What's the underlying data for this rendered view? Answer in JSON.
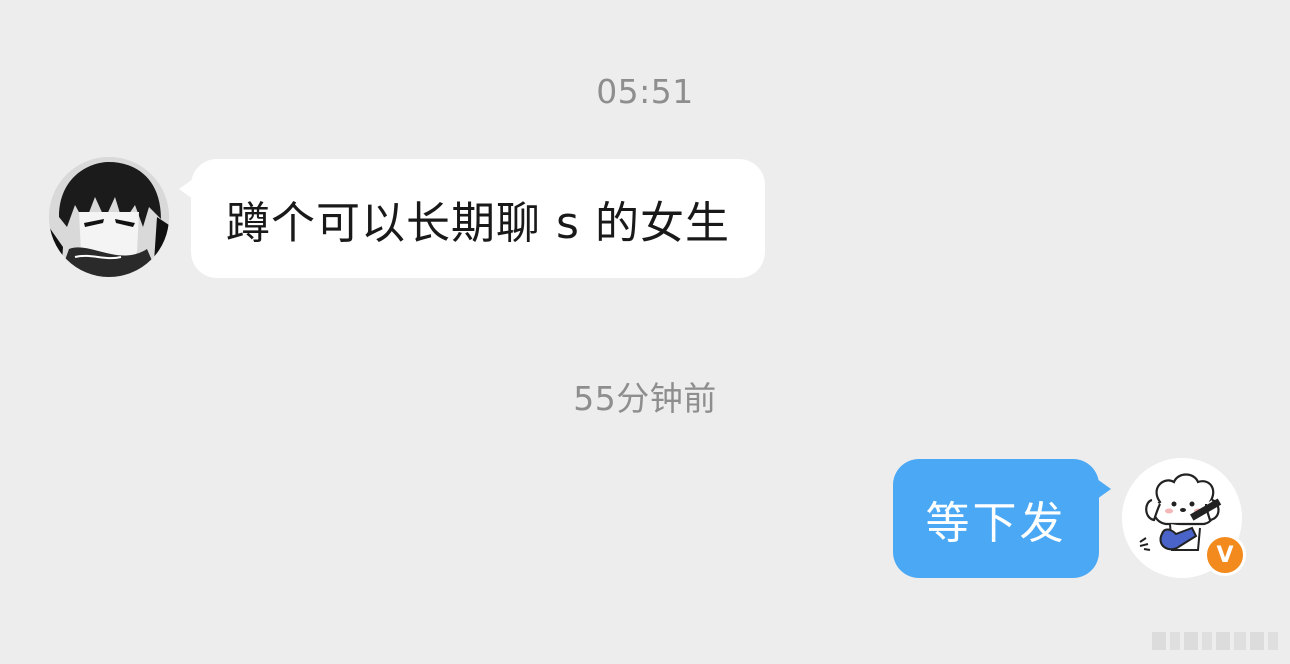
{
  "chat": {
    "timestamp_1": "05:51",
    "timestamp_2": "55分钟前",
    "messages": [
      {
        "side": "incoming",
        "text": "蹲个可以长期聊 s 的女生",
        "avatar_icon": "anime-boy-avatar-icon"
      },
      {
        "side": "outgoing",
        "text": "等下发",
        "avatar_icon": "puppy-guitar-avatar-icon"
      }
    ],
    "verified_badge": "V"
  },
  "colors": {
    "background": "#ededed",
    "incoming_bubble": "#ffffff",
    "outgoing_bubble": "#4aa8f5",
    "timestamp_text": "#8e8e8e",
    "badge": "#f28a1e"
  }
}
